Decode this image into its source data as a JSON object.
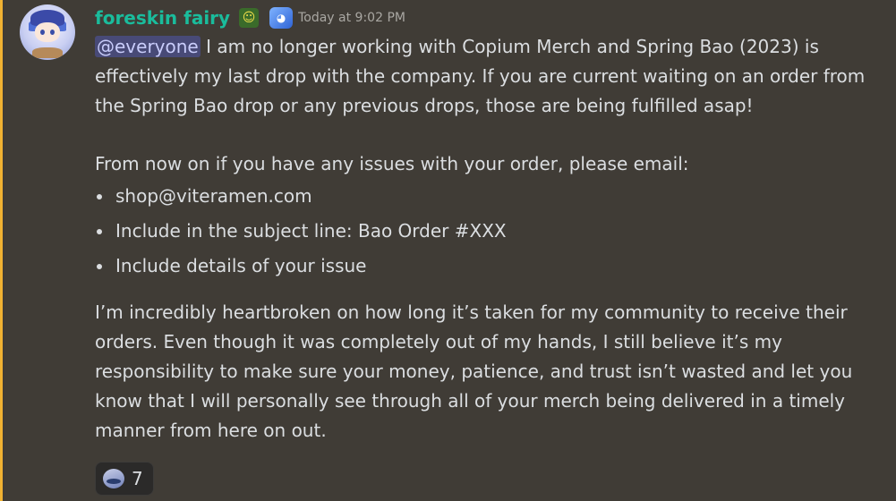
{
  "author": {
    "username": "foreskin fairy",
    "timestamp": "Today at 9:02 PM",
    "badge_icons": [
      "person-badge-icon",
      "avatar-badge-icon"
    ]
  },
  "message": {
    "mention": "@everyone",
    "para1_rest": " I am no longer working with Copium Merch and Spring Bao (2023) is effectively my last drop with the company. If you are current waiting on an order from the Spring Bao drop or any previous drops, those are being fulfilled asap!",
    "para2": "From now on if you have any issues with your order, please email:",
    "bullets": [
      "shop@viteramen.com",
      "Include in the subject line: Bao Order #XXX",
      "Include details of your issue"
    ],
    "para3": "I’m incredibly heartbroken on how long it’s taken for my community to receive their orders. Even though it was completely out of my hands, I still believe it’s my responsibility to make sure your money, patience, and trust isn’t wasted and let you know that I will personally see through all of your merch being delivered in a timely manner from here on out."
  },
  "reaction": {
    "emoji": "sleepy-face-emoji-icon",
    "count": "7"
  },
  "colors": {
    "background": "#403c36",
    "username": "#1abc9c",
    "mention_bg": "#5865f2",
    "accent_bar": "#f0b232"
  }
}
